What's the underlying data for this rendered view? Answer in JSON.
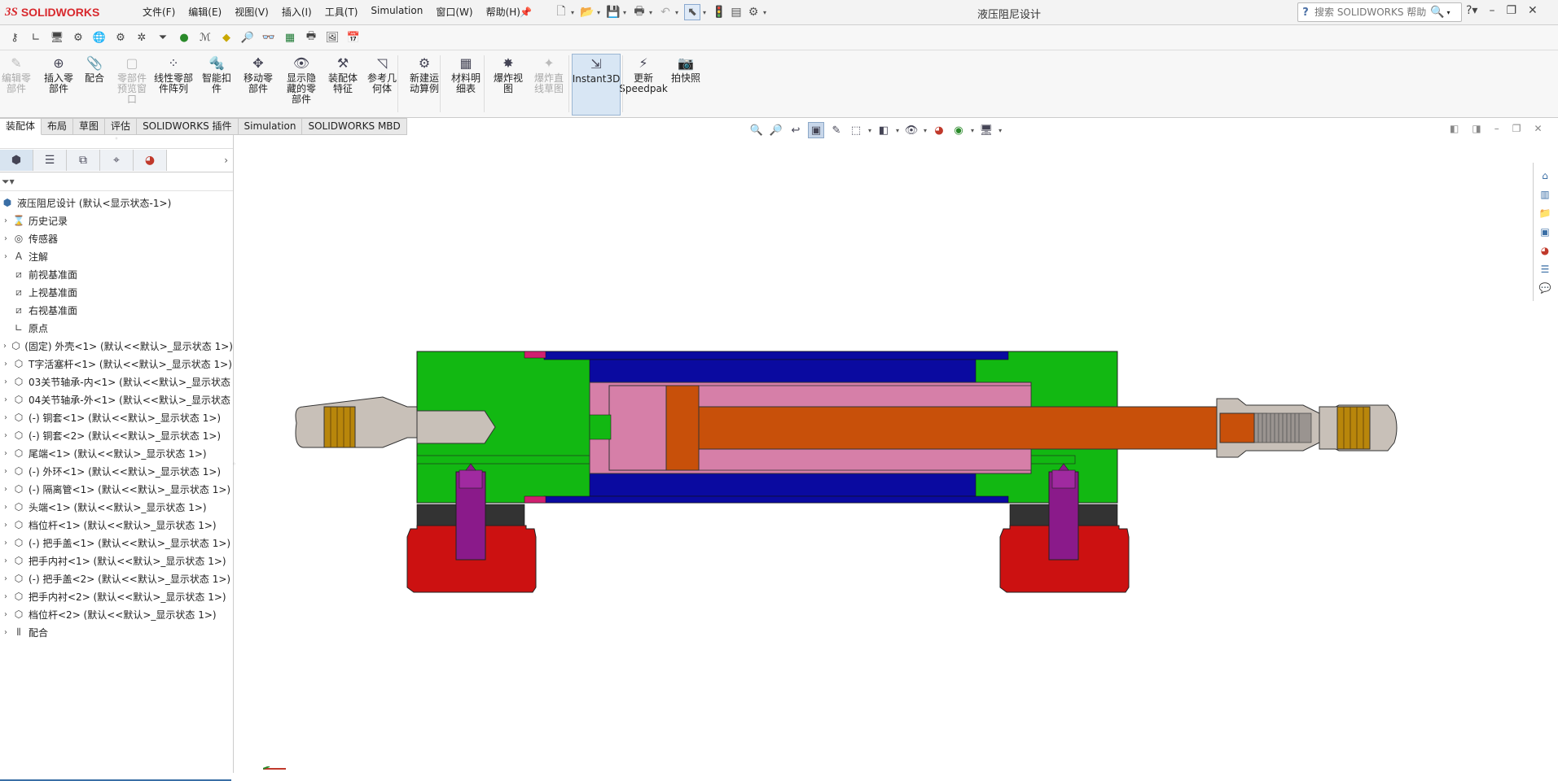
{
  "app": {
    "brand_ds": "3S",
    "brand_name": "SOLIDWORKS"
  },
  "menu": [
    "文件(F)",
    "编辑(E)",
    "视图(V)",
    "插入(I)",
    "工具(T)",
    "Simulation",
    "窗口(W)",
    "帮助(H)"
  ],
  "window": {
    "title": "液压阻尼设计"
  },
  "search": {
    "placeholder": "搜索 SOLIDWORKS 帮助"
  },
  "ribbon": [
    {
      "label": "编辑零\n部件",
      "icon": "edit-component-icon",
      "disabled": true
    },
    {
      "label": "插入零\n部件",
      "icon": "insert-component-icon",
      "disabled": false
    },
    {
      "label": "配合",
      "icon": "mate-icon",
      "disabled": false
    },
    {
      "label": "零部件\n预览窗\n口",
      "icon": "component-preview-icon",
      "disabled": true
    },
    {
      "label": "线性零部\n件阵列",
      "icon": "linear-pattern-icon",
      "disabled": false
    },
    {
      "label": "智能扣\n件",
      "icon": "smart-fasteners-icon",
      "disabled": false
    },
    {
      "label": "移动零\n部件",
      "icon": "move-component-icon",
      "disabled": false
    },
    {
      "label": "显示隐\n藏的零\n部件",
      "icon": "show-hidden-icon",
      "disabled": false
    },
    {
      "label": "装配体\n特征",
      "icon": "assembly-features-icon",
      "disabled": false
    },
    {
      "label": "参考几\n何体",
      "icon": "reference-geometry-icon",
      "disabled": false
    },
    {
      "label": "新建运\n动算例",
      "icon": "motion-study-icon",
      "disabled": false
    },
    {
      "label": "材料明\n细表",
      "icon": "bom-icon",
      "disabled": false
    },
    {
      "label": "爆炸视\n图",
      "icon": "exploded-view-icon",
      "disabled": false
    },
    {
      "label": "爆炸直\n线草图",
      "icon": "explode-line-icon",
      "disabled": true
    },
    {
      "label": "Instant3D",
      "icon": "instant3d-icon",
      "disabled": false
    },
    {
      "label": "更新\nSpeedpak",
      "icon": "speedpak-icon",
      "disabled": false
    },
    {
      "label": "拍快照",
      "icon": "snapshot-icon",
      "disabled": false
    }
  ],
  "tabs": [
    "装配体",
    "布局",
    "草图",
    "评估",
    "SOLIDWORKS 插件",
    "Simulation",
    "SOLIDWORKS MBD"
  ],
  "tree": {
    "root": "液压阻尼设计  (默认<显示状态-1>)",
    "items": [
      {
        "label": "历史记录",
        "icon": "history-icon"
      },
      {
        "label": "传感器",
        "icon": "sensor-icon"
      },
      {
        "label": "注解",
        "icon": "annotation-icon"
      },
      {
        "label": "前视基准面",
        "icon": "plane-icon"
      },
      {
        "label": "上视基准面",
        "icon": "plane-icon"
      },
      {
        "label": "右视基准面",
        "icon": "plane-icon"
      },
      {
        "label": "原点",
        "icon": "origin-icon"
      },
      {
        "label": "(固定) 外壳<1> (默认<<默认>_显示状态 1>)",
        "icon": "part-icon"
      },
      {
        "label": "T字活塞杆<1> (默认<<默认>_显示状态 1>)",
        "icon": "part-icon"
      },
      {
        "label": "03关节轴承-内<1> (默认<<默认>_显示状态",
        "icon": "part-icon"
      },
      {
        "label": "04关节轴承-外<1> (默认<<默认>_显示状态",
        "icon": "part-icon"
      },
      {
        "label": "(-) 铜套<1> (默认<<默认>_显示状态 1>)",
        "icon": "part-icon"
      },
      {
        "label": "(-) 铜套<2> (默认<<默认>_显示状态 1>)",
        "icon": "part-icon"
      },
      {
        "label": "尾端<1> (默认<<默认>_显示状态 1>)",
        "icon": "part-icon"
      },
      {
        "label": "(-) 外环<1> (默认<<默认>_显示状态 1>)",
        "icon": "part-icon"
      },
      {
        "label": "(-) 隔离管<1> (默认<<默认>_显示状态 1>)",
        "icon": "part-icon"
      },
      {
        "label": "头端<1> (默认<<默认>_显示状态 1>)",
        "icon": "part-icon"
      },
      {
        "label": "档位杆<1> (默认<<默认>_显示状态 1>)",
        "icon": "part-icon"
      },
      {
        "label": "(-) 把手盖<1> (默认<<默认>_显示状态 1>)",
        "icon": "part-icon"
      },
      {
        "label": "把手内衬<1> (默认<<默认>_显示状态 1>)",
        "icon": "part-icon"
      },
      {
        "label": "(-) 把手盖<2> (默认<<默认>_显示状态 1>)",
        "icon": "part-icon"
      },
      {
        "label": "把手内衬<2> (默认<<默认>_显示状态 1>)",
        "icon": "part-icon"
      },
      {
        "label": "档位杆<2> (默认<<默认>_显示状态 1>)",
        "icon": "part-icon"
      },
      {
        "label": "配合",
        "icon": "mates-folder-icon"
      }
    ]
  },
  "colors": {
    "housing": "#12b812",
    "tube": "#0a0aa0",
    "piston": "#d67fa8",
    "rod": "#c8500a",
    "bearing": "#c8c0b8",
    "bushing": "#b8860b",
    "handle": "#cc1111",
    "lever": "#8a1a8a",
    "clamp": "#333333",
    "brand": "#d8282d"
  }
}
